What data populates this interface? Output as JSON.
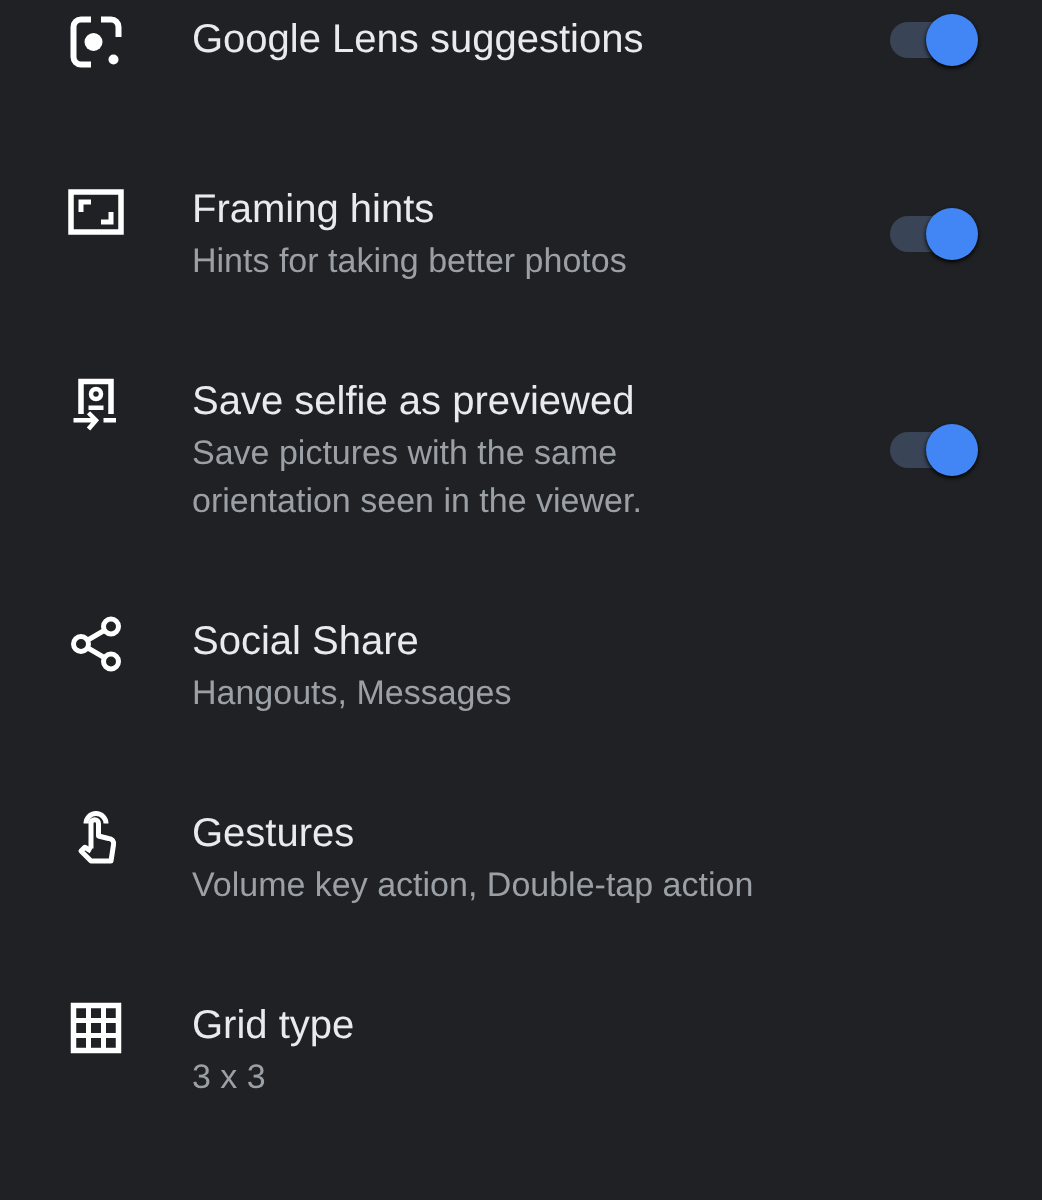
{
  "settings": [
    {
      "title": "Google Lens suggestions",
      "on": true
    },
    {
      "title": "Framing hints",
      "subtitle": "Hints for taking better photos",
      "on": true
    },
    {
      "title": "Save selfie as previewed",
      "subtitle": "Save pictures with the same orientation seen in the viewer.",
      "on": true
    },
    {
      "title": "Social Share",
      "subtitle": "Hangouts, Messages"
    },
    {
      "title": "Gestures",
      "subtitle": "Volume key action, Double-tap action"
    },
    {
      "title": "Grid type",
      "subtitle": "3 x 3"
    }
  ]
}
